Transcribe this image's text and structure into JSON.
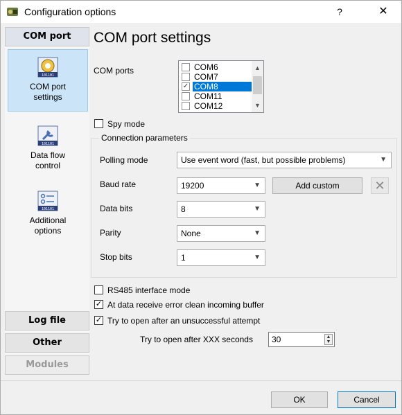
{
  "window": {
    "title": "Configuration options",
    "help_label": "?",
    "close_label": "✕"
  },
  "sidebar": {
    "headers": {
      "com_port": "COM port",
      "log_file": "Log file",
      "other": "Other",
      "modules": "Modules"
    },
    "items": [
      {
        "label_line1": "COM port",
        "label_line2": "settings",
        "icon": "com-port-settings-icon"
      },
      {
        "label_line1": "Data flow",
        "label_line2": "control",
        "icon": "data-flow-control-icon"
      },
      {
        "label_line1": "Additional",
        "label_line2": "options",
        "icon": "additional-options-icon"
      }
    ]
  },
  "main": {
    "title": "COM port settings",
    "com_ports_label": "COM ports",
    "com_ports": [
      {
        "name": "COM6",
        "checked": false,
        "selected": false
      },
      {
        "name": "COM7",
        "checked": false,
        "selected": false
      },
      {
        "name": "COM8",
        "checked": true,
        "selected": true
      },
      {
        "name": "COM11",
        "checked": false,
        "selected": false
      },
      {
        "name": "COM12",
        "checked": false,
        "selected": false
      }
    ],
    "spy_mode": {
      "label": "Spy mode",
      "checked": false
    },
    "connection": {
      "group_title": "Connection parameters",
      "polling_mode": {
        "label": "Polling mode",
        "value": "Use event word (fast, but possible problems)"
      },
      "baud_rate": {
        "label": "Baud rate",
        "value": "19200"
      },
      "add_custom_label": "Add custom",
      "data_bits": {
        "label": "Data bits",
        "value": "8"
      },
      "parity": {
        "label": "Parity",
        "value": "None"
      },
      "stop_bits": {
        "label": "Stop bits",
        "value": "1"
      }
    },
    "rs485": {
      "label": "RS485 interface mode",
      "checked": false
    },
    "clean_buffer": {
      "label": "At data receive error clean incoming buffer",
      "checked": true
    },
    "try_open": {
      "label": "Try to open after an unsuccessful attempt",
      "checked": true
    },
    "retry_seconds": {
      "label": "Try to open after XXX seconds",
      "value": "30"
    }
  },
  "footer": {
    "ok_label": "OK",
    "cancel_label": "Cancel"
  },
  "colors": {
    "selection": "#0078d7",
    "sidebar_selected": "#cce4f7"
  }
}
